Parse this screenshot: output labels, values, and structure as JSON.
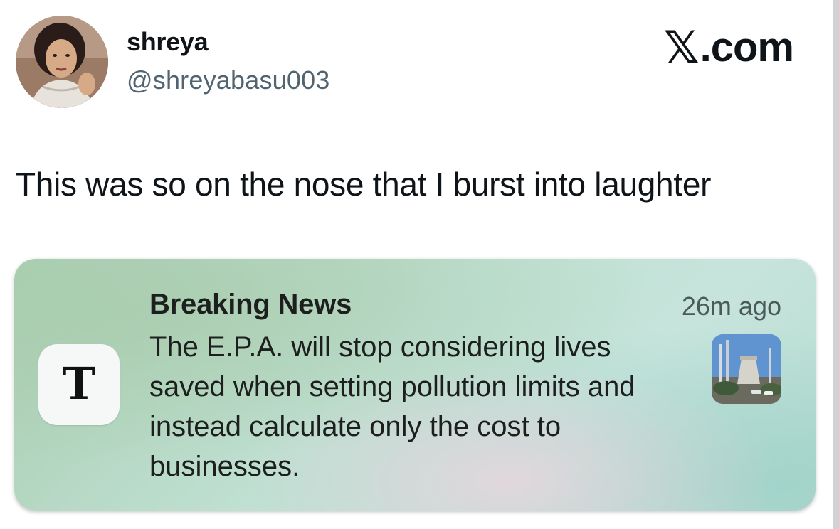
{
  "author": {
    "display_name": "shreya",
    "handle": "@shreyabasu003",
    "avatar_icon": "profile-photo"
  },
  "brand": {
    "logo_icon": "x-logo-icon",
    "logo_glyph": "𝕏",
    "suffix": ".com"
  },
  "tweet": {
    "text": "This was so on the nose that I burst into laughter"
  },
  "notification": {
    "app_icon": "nyt-logo-icon",
    "app_glyph": "T",
    "title": "Breaking News",
    "time": "26m ago",
    "body": "The E.P.A. will stop considering lives saved when setting pollution limits and instead calculate only the cost to businesses.",
    "thumbnail_icon": "power-plant-thumbnail"
  }
}
